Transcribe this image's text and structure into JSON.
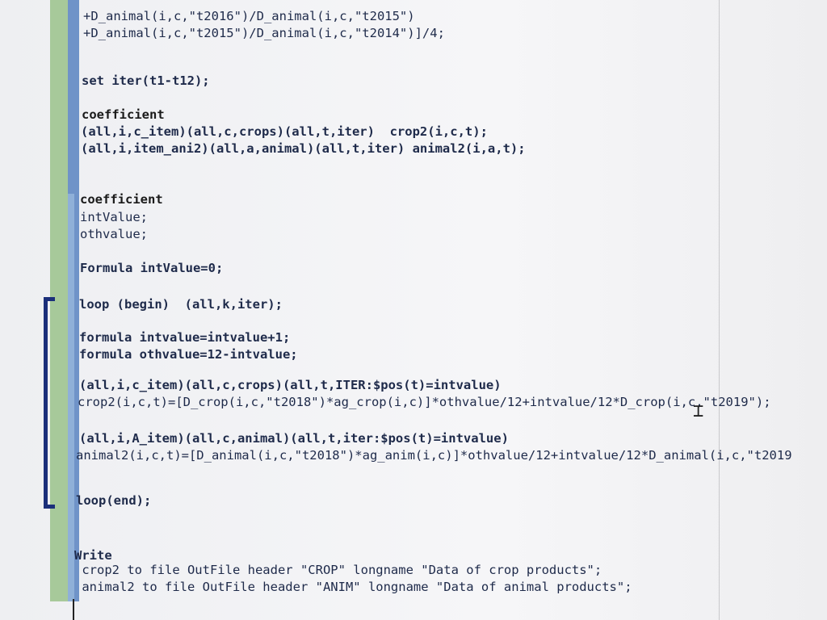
{
  "editor": {
    "lines": [
      {
        "id": "l1",
        "text": "+D_animal(i,c,\"t2016\")/D_animal(i,c,\"t2015\")"
      },
      {
        "id": "l2",
        "text": "+D_animal(i,c,\"t2015\")/D_animal(i,c,\"t2014\")]/4;"
      },
      {
        "id": "l3",
        "text": "set iter(t1-t12);"
      },
      {
        "id": "l4",
        "text": "coefficient"
      },
      {
        "id": "l5",
        "text": "(all,i,c_item)(all,c,crops)(all,t,iter)  crop2(i,c,t);"
      },
      {
        "id": "l6",
        "text": "(all,i,item_ani2)(all,a,animal)(all,t,iter) animal2(i,a,t);"
      },
      {
        "id": "l7",
        "text": "coefficient"
      },
      {
        "id": "l8",
        "text": "intValue;"
      },
      {
        "id": "l9",
        "text": "othvalue;"
      },
      {
        "id": "l10",
        "text": "Formula intValue=0;"
      },
      {
        "id": "l11",
        "text": "loop (begin)  (all,k,iter);"
      },
      {
        "id": "l12",
        "text": "formula intvalue=intvalue+1;"
      },
      {
        "id": "l13",
        "text": "formula othvalue=12-intvalue;"
      },
      {
        "id": "l14",
        "text": "(all,i,c_item)(all,c,crops)(all,t,ITER:$pos(t)=intvalue)"
      },
      {
        "id": "l15",
        "text": "crop2(i,c,t)=[D_crop(i,c,\"t2018\")*ag_crop(i,c)]*othvalue/12+intvalue/12*D_crop(i,c,\"t2019\");"
      },
      {
        "id": "l16",
        "text": "(all,i,A_item)(all,c,animal)(all,t,iter:$pos(t)=intvalue)"
      },
      {
        "id": "l17",
        "text": "animal2(i,c,t)=[D_animal(i,c,\"t2018\")*ag_anim(i,c)]*othvalue/12+intvalue/12*D_animal(i,c,\"t2019"
      },
      {
        "id": "l18",
        "text": "loop(end);"
      },
      {
        "id": "l19",
        "text": "Write"
      },
      {
        "id": "l20",
        "text": " crop2 to file OutFile header \"CROP\" longname \"Data of crop products\";"
      },
      {
        "id": "l21",
        "text": " animal2 to file OutFile header \"ANIM\" longname \"Data of animal products\";"
      }
    ]
  }
}
